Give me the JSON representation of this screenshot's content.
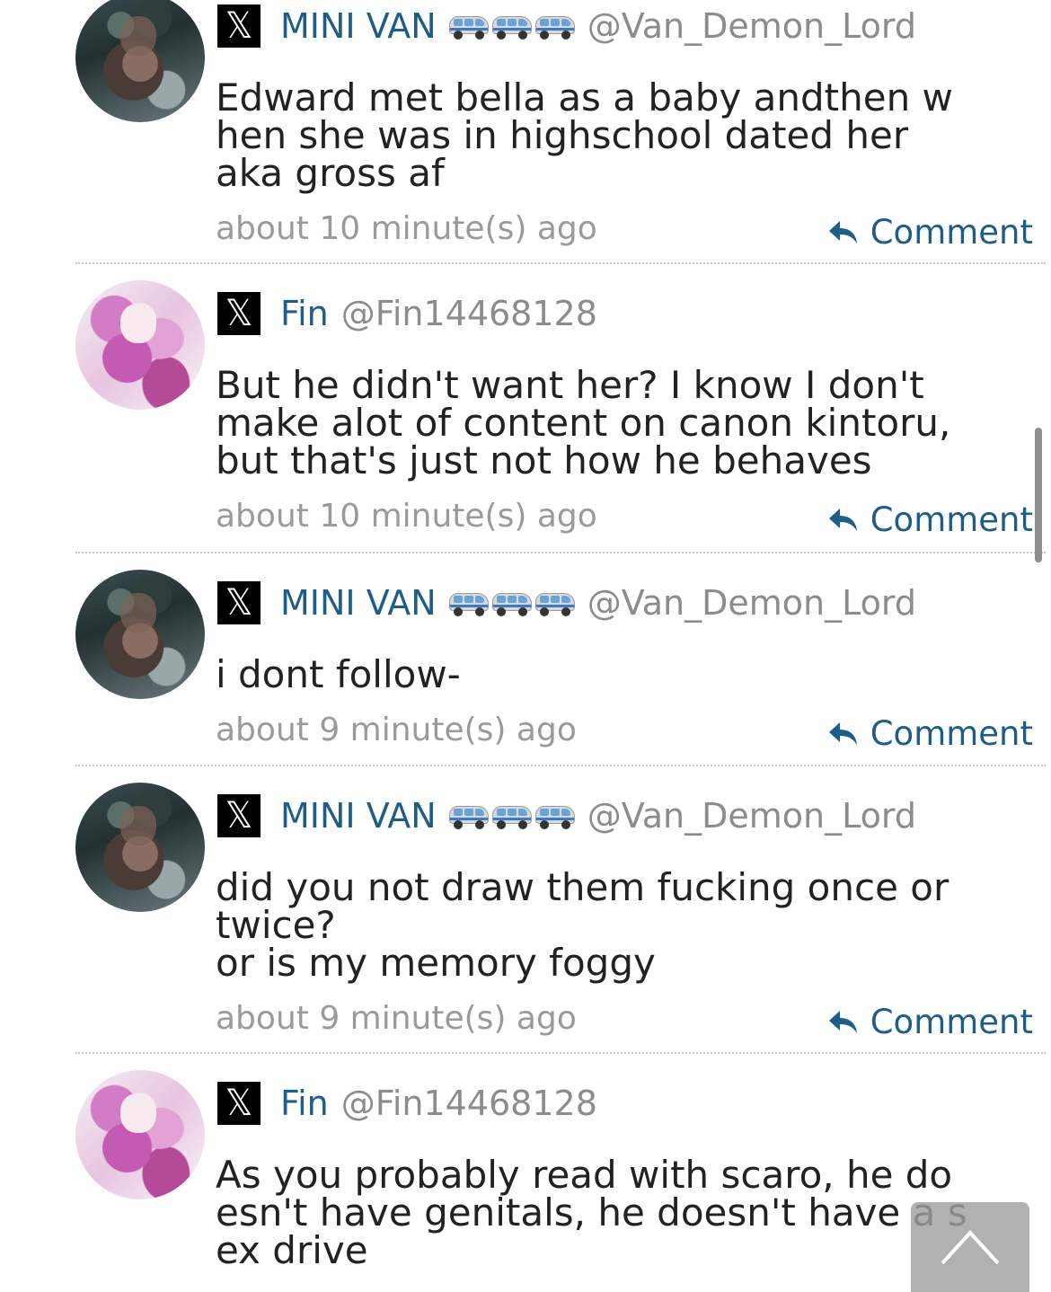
{
  "app": {
    "source_icon": "x-logo-icon",
    "comment_icon": "reply-arrow-icon",
    "scroll_top_icon": "up-arrow-icon",
    "colors": {
      "link": "#1e5d87",
      "muted": "#9a9a9a",
      "text": "#222222",
      "divider": "#c7c7c7"
    }
  },
  "comments": [
    {
      "display_name": "MINI VAN",
      "has_van_emoji": true,
      "handle": "@Van_Demon_Lord",
      "text": "Edward met bella as a baby andthen w\nhen she was in highschool dated her\naka gross af",
      "time": "about 10 minute(s) ago",
      "action": "Comment"
    },
    {
      "display_name": "Fin",
      "has_van_emoji": false,
      "handle": "@Fin14468128",
      "text": "But he didn't want her? I know I don't\nmake alot of content on canon kintoru,\nbut that's just not how he behaves",
      "time": "about 10 minute(s) ago",
      "action": "Comment"
    },
    {
      "display_name": "MINI VAN",
      "has_van_emoji": true,
      "handle": "@Van_Demon_Lord",
      "text": "i dont follow-",
      "time": "about 9 minute(s) ago",
      "action": "Comment"
    },
    {
      "display_name": "MINI VAN",
      "has_van_emoji": true,
      "handle": "@Van_Demon_Lord",
      "text": "did you not draw them fucking once or\ntwice?\nor is my memory foggy",
      "time": "about 9 minute(s) ago",
      "action": "Comment"
    },
    {
      "display_name": "Fin",
      "has_van_emoji": false,
      "handle": "@Fin14468128",
      "text": "As you probably read with scaro, he do\nesn't have genitals, he doesn't have a s\nex drive",
      "time": "",
      "action": ""
    }
  ]
}
